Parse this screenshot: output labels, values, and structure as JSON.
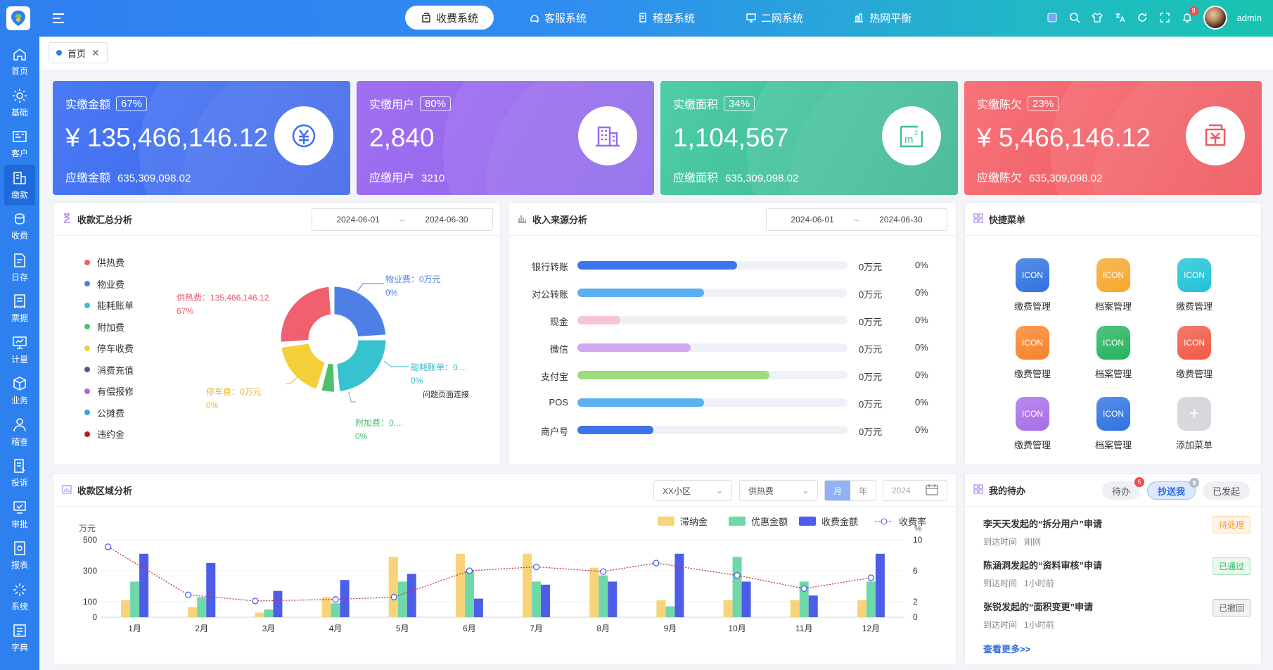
{
  "sidebar": {
    "items": [
      {
        "label": "首页",
        "icon": "home-icon"
      },
      {
        "label": "基础",
        "icon": "gear-icon"
      },
      {
        "label": "客户",
        "icon": "customer-card-icon"
      },
      {
        "label": "缴款",
        "icon": "payment-icon"
      },
      {
        "label": "收费",
        "icon": "coins-icon"
      },
      {
        "label": "日存",
        "icon": "deposit-icon"
      },
      {
        "label": "票据",
        "icon": "receipt-icon"
      },
      {
        "label": "计量",
        "icon": "meter-icon"
      },
      {
        "label": "业务",
        "icon": "cube-icon"
      },
      {
        "label": "稽查",
        "icon": "inspector-icon"
      },
      {
        "label": "投诉",
        "icon": "complaint-icon"
      },
      {
        "label": "审批",
        "icon": "approve-icon"
      },
      {
        "label": "报表",
        "icon": "report-icon"
      },
      {
        "label": "系统",
        "icon": "system-icon"
      },
      {
        "label": "字典",
        "icon": "dictionary-icon"
      }
    ]
  },
  "topnav": {
    "systems": [
      {
        "label": "收费系统",
        "icon": "register-icon",
        "active": true
      },
      {
        "label": "客服系统",
        "icon": "headset-icon",
        "active": false
      },
      {
        "label": "稽查系统",
        "icon": "audit-icon",
        "active": false
      },
      {
        "label": "二网系统",
        "icon": "monitor-icon",
        "active": false
      },
      {
        "label": "热网平衡",
        "icon": "balance-icon",
        "active": false
      }
    ],
    "notification_count": "8",
    "username": "admin"
  },
  "tabs": {
    "home": "首页"
  },
  "stats": [
    {
      "label": "实缴金额",
      "percent": "67%",
      "value": "¥ 135,466,146.12",
      "sub_label": "应缴金额",
      "sub_value": "635,309,098.02",
      "icon": "yuan-icon",
      "color": "#3f6ff0"
    },
    {
      "label": "实缴用户",
      "percent": "80%",
      "value": "2,840",
      "sub_label": "应缴用户",
      "sub_value": "3210",
      "icon": "building-icon",
      "color": "#9a6cf0"
    },
    {
      "label": "实缴面积",
      "percent": "34%",
      "value": "1,104,567",
      "sub_label": "应缴面积",
      "sub_value": "635,309,098.02",
      "icon": "square-meter-icon",
      "color": "#3fbf9c"
    },
    {
      "label": "实缴陈欠",
      "percent": "23%",
      "value": "¥ 5,466,146.12",
      "sub_label": "应缴陈欠",
      "sub_value": "635,309,098.02",
      "icon": "money-box-icon",
      "color": "#f05a5e"
    }
  ],
  "summary": {
    "title": "收款汇总分析",
    "date_from": "2024-06-01",
    "date_sep": "–",
    "date_to": "2024-06-30",
    "legend": [
      {
        "name": "供热费",
        "color": "#f0606e"
      },
      {
        "name": "物业费",
        "color": "#4e7fe6"
      },
      {
        "name": "能耗账单",
        "color": "#36c3cf"
      },
      {
        "name": "附加费",
        "color": "#4fbf6b"
      },
      {
        "name": "停车收费",
        "color": "#f5cf3a"
      },
      {
        "name": "消费充值",
        "color": "#4a5d7e"
      },
      {
        "name": "有偿报修",
        "color": "#a56cd9"
      },
      {
        "name": "公摊费",
        "color": "#3aa0e8"
      },
      {
        "name": "违约金",
        "color": "#b22222"
      }
    ],
    "callouts": {
      "heat": {
        "line1": "供热费：135,466,146.12",
        "line2": "67%"
      },
      "property": {
        "line1": "物业费：0万元",
        "line2": "0%"
      },
      "energy": {
        "line1": "能耗账单：0....",
        "line2": "0%"
      },
      "extra": {
        "line1": "附加费：0....",
        "line2": "0%"
      },
      "parking": {
        "line1": "停车费：0万元",
        "line2": "0%"
      }
    },
    "link": "问题页面连接"
  },
  "income": {
    "title": "收入来源分析",
    "date_from": "2024-06-01",
    "date_sep": "–",
    "date_to": "2024-06-30",
    "rows": [
      {
        "name": "银行转账",
        "fill": 0.59,
        "color": "#3b74ec",
        "value": "0万元",
        "pct": "0%"
      },
      {
        "name": "对公转账",
        "fill": 0.47,
        "color": "#5ab0f0",
        "value": "0万元",
        "pct": "0%"
      },
      {
        "name": "现金",
        "fill": 0.16,
        "color": "#f7c6d0",
        "value": "0万元",
        "pct": "0%"
      },
      {
        "name": "微信",
        "fill": 0.42,
        "color": "#d2a8f2",
        "value": "0万元",
        "pct": "0%"
      },
      {
        "name": "支付宝",
        "fill": 0.71,
        "color": "#9bdc7c",
        "value": "0万元",
        "pct": "0%"
      },
      {
        "name": "POS",
        "fill": 0.47,
        "color": "#5ab0f0",
        "value": "0万元",
        "pct": "0%"
      },
      {
        "name": "商户号",
        "fill": 0.28,
        "color": "#3b74ec",
        "value": "0万元",
        "pct": "0%"
      }
    ]
  },
  "quick": {
    "title": "快捷菜单",
    "items": [
      {
        "label": "缴费管理",
        "icon_text": "ICON",
        "color": "#2f72e0"
      },
      {
        "label": "档案管理",
        "icon_text": "ICON",
        "color": "#f7a72c"
      },
      {
        "label": "缴费管理",
        "icon_text": "ICON",
        "color": "#1ec3d6"
      },
      {
        "label": "缴费管理",
        "icon_text": "ICON",
        "color": "#f7832a"
      },
      {
        "label": "档案管理",
        "icon_text": "ICON",
        "color": "#25b45c"
      },
      {
        "label": "缴费管理",
        "icon_text": "ICON",
        "color": "#f25a45"
      },
      {
        "label": "缴费管理",
        "icon_text": "ICON",
        "color": "#a86ee8"
      },
      {
        "label": "档案管理",
        "icon_text": "ICON",
        "color": "#2f72e0"
      },
      {
        "label": "添加菜单",
        "icon_text": "+",
        "color": "#d6d8de"
      }
    ]
  },
  "region": {
    "title": "收款区域分析",
    "filter_area": "XX小区",
    "filter_fee": "供热费",
    "seg_month": "月",
    "seg_year": "年",
    "year": "2024"
  },
  "chart_data": {
    "type": "bar",
    "categories": [
      "1月",
      "2月",
      "3月",
      "4月",
      "5月",
      "6月",
      "7月",
      "8月",
      "9月",
      "10月",
      "11月",
      "12月"
    ],
    "series": [
      {
        "name": "滞纳金",
        "type": "bar",
        "color": "#f8d479",
        "values": [
          110,
          65,
          30,
          130,
          390,
          410,
          410,
          320,
          110,
          110,
          110,
          110
        ]
      },
      {
        "name": "优惠金额",
        "type": "bar",
        "color": "#6fd8a8",
        "values": [
          230,
          130,
          50,
          90,
          230,
          300,
          230,
          270,
          70,
          390,
          230,
          230
        ]
      },
      {
        "name": "收费金额",
        "type": "bar",
        "color": "#4d5de8",
        "values": [
          410,
          350,
          170,
          240,
          280,
          120,
          210,
          230,
          410,
          230,
          140,
          410
        ]
      },
      {
        "name": "收费率",
        "type": "line",
        "axis": "right",
        "color": "#c0354a",
        "values": [
          9.1,
          2.9,
          2.1,
          2.3,
          2.6,
          6.0,
          6.5,
          5.9,
          7.0,
          5.4,
          3.7,
          5.1
        ]
      }
    ],
    "left_axis": {
      "unit": "万元",
      "ticks": [
        "500",
        "300",
        "100",
        "0"
      ],
      "range": [
        0,
        500
      ]
    },
    "right_axis": {
      "unit": "%",
      "ticks": [
        "10",
        "6",
        "2",
        "0"
      ],
      "range": [
        0,
        10
      ]
    }
  },
  "todo": {
    "title": "我的待办",
    "tabs": [
      {
        "label": "待办",
        "badge": "5",
        "badge_color": "#f04a4a",
        "active": false
      },
      {
        "label": "抄送我",
        "badge": "9",
        "badge_color": "#b6bcc8",
        "active": true
      },
      {
        "label": "已发起",
        "badge": "",
        "badge_color": "",
        "active": false
      }
    ],
    "items": [
      {
        "title": "李天天发起的“拆分用户”申请",
        "time_label": "到达时间",
        "time": "刚刚",
        "status": "待处理",
        "status_color": "#f09a2a"
      },
      {
        "title": "陈涵洞发起的“资料审核”申请",
        "time_label": "到达时间",
        "time": "1小时前",
        "status": "已通过",
        "status_color": "#2eb85c"
      },
      {
        "title": "张锐发起的“面积变更”申请",
        "time_label": "到达时间",
        "time": "1小时前",
        "status": "已撤回",
        "status_color": "#666666"
      }
    ],
    "more": "查看更多>>"
  }
}
